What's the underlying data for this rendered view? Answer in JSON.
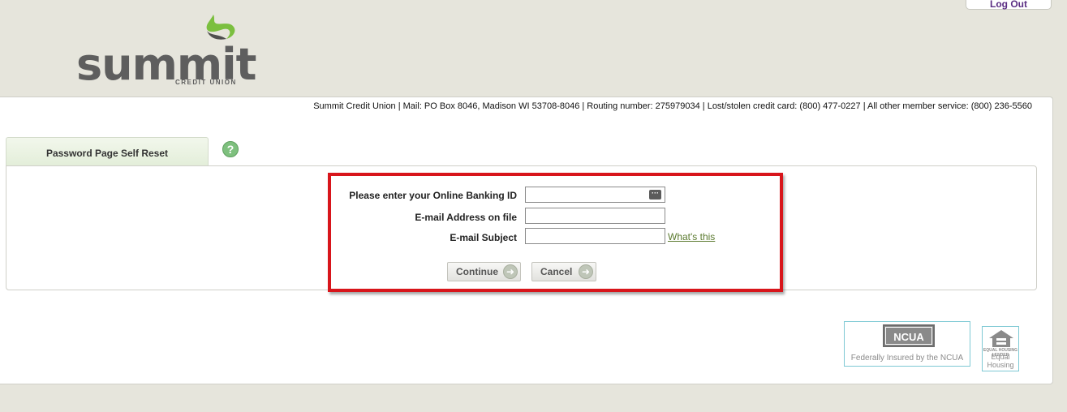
{
  "header": {
    "logout_label": "Log Out",
    "logo_text": "summit",
    "logo_subtext": "CREDIT UNION"
  },
  "info_bar": "Summit Credit Union | Mail: PO Box 8046, Madison WI 53708-8046 | Routing number: 275979034 | Lost/stolen credit card: (800) 477-0227 | All other member service: (800) 236-5560",
  "tab": {
    "label": "Password Page Self Reset",
    "help_icon": "?"
  },
  "form": {
    "banking_id": {
      "label": "Please enter your Online Banking ID",
      "value": ""
    },
    "email": {
      "label": "E-mail Address on file",
      "value": ""
    },
    "subject": {
      "label": "E-mail Subject",
      "value": ""
    },
    "whats_this": "What's this",
    "continue_label": "Continue",
    "cancel_label": "Cancel"
  },
  "badges": {
    "ncua_logo": "NCUA",
    "ncua_text": "Federally Insured by the NCUA",
    "eh_small": "EQUAL HOUSING LENDER",
    "eh_text_line1": "Equal",
    "eh_text_line2": "Housing"
  },
  "colors": {
    "brand_green": "#7ec07e",
    "highlight_red": "#d8151b",
    "link_green": "#5b7a2f"
  }
}
